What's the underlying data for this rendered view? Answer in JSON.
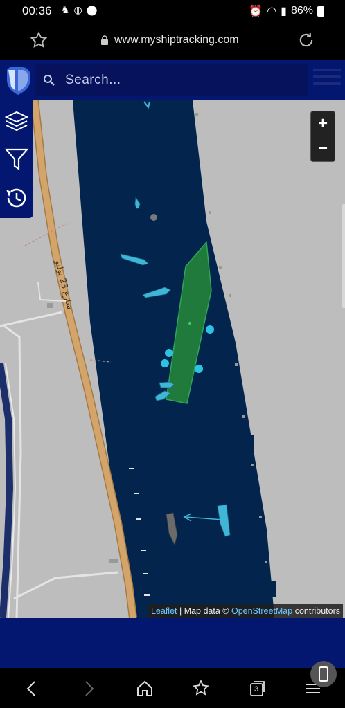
{
  "status_bar": {
    "time": "00:36",
    "battery": "86%"
  },
  "browser": {
    "url": "www.myshiptracking.com"
  },
  "app": {
    "search_placeholder": "Search..."
  },
  "map": {
    "street_label": "شارع 23 يوليو",
    "attribution": {
      "leaflet": "Leaflet",
      "separator": " | Map data © ",
      "osm": "OpenStreetMap",
      "suffix": " contributors"
    },
    "zoom_in": "+",
    "zoom_out": "−"
  },
  "icons": {
    "sidebar": [
      "layers-icon",
      "filter-icon",
      "history-icon"
    ],
    "navbar": [
      "back-icon",
      "forward-icon",
      "home-icon",
      "bookmarks-icon",
      "tabs-icon",
      "menu-icon"
    ]
  },
  "navbar": {
    "tab_count": "3"
  },
  "colors": {
    "header": "#041770",
    "water": "#03254d",
    "land": "#bdbdbd",
    "road": "#d4a56b",
    "vessel_large": "#1f7a3c",
    "vessel_small": "#3fb6d6"
  }
}
